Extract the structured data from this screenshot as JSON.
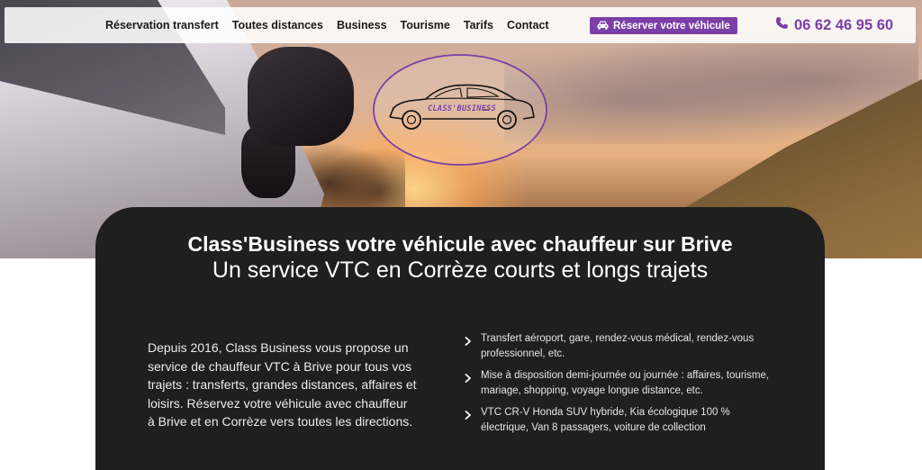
{
  "nav": {
    "links": [
      "Réservation transfert",
      "Toutes distances",
      "Business",
      "Tourisme",
      "Tarifs",
      "Contact"
    ],
    "reserve_button": "Réserver votre véhicule",
    "reserve_icon": "car-icon",
    "phone": "06 62 46 95 60",
    "phone_icon": "phone-icon"
  },
  "logo": {
    "text": "CLASS'BUSINESS"
  },
  "hero": {
    "title": "Class'Business votre véhicule avec chauffeur sur Brive",
    "subtitle": "Un service VTC en Corrèze courts et longs trajets"
  },
  "intro": "Depuis 2016, Class Business vous propose un service de chauffeur VTC à Brive pour tous vos trajets : transferts, grandes distances, affaires et loisirs. Réservez votre véhicule avec chauffeur à Brive et en Corrèze vers toutes les directions.",
  "services": [
    "Transfert aéroport, gare, rendez-vous médical, rendez-vous professionnel, etc.",
    "Mise à disposition demi-journée ou journée : affaires, tourisme, mariage, shopping, voyage longue distance, etc.",
    "VTC CR-V Honda SUV hybride, Kia écologique 100 % électrique, Van 8 passagers, voiture de collection"
  ],
  "colors": {
    "accent": "#7b3fa8",
    "card_bg": "#1f1f1f",
    "text_dark": "#1a1a1a"
  }
}
